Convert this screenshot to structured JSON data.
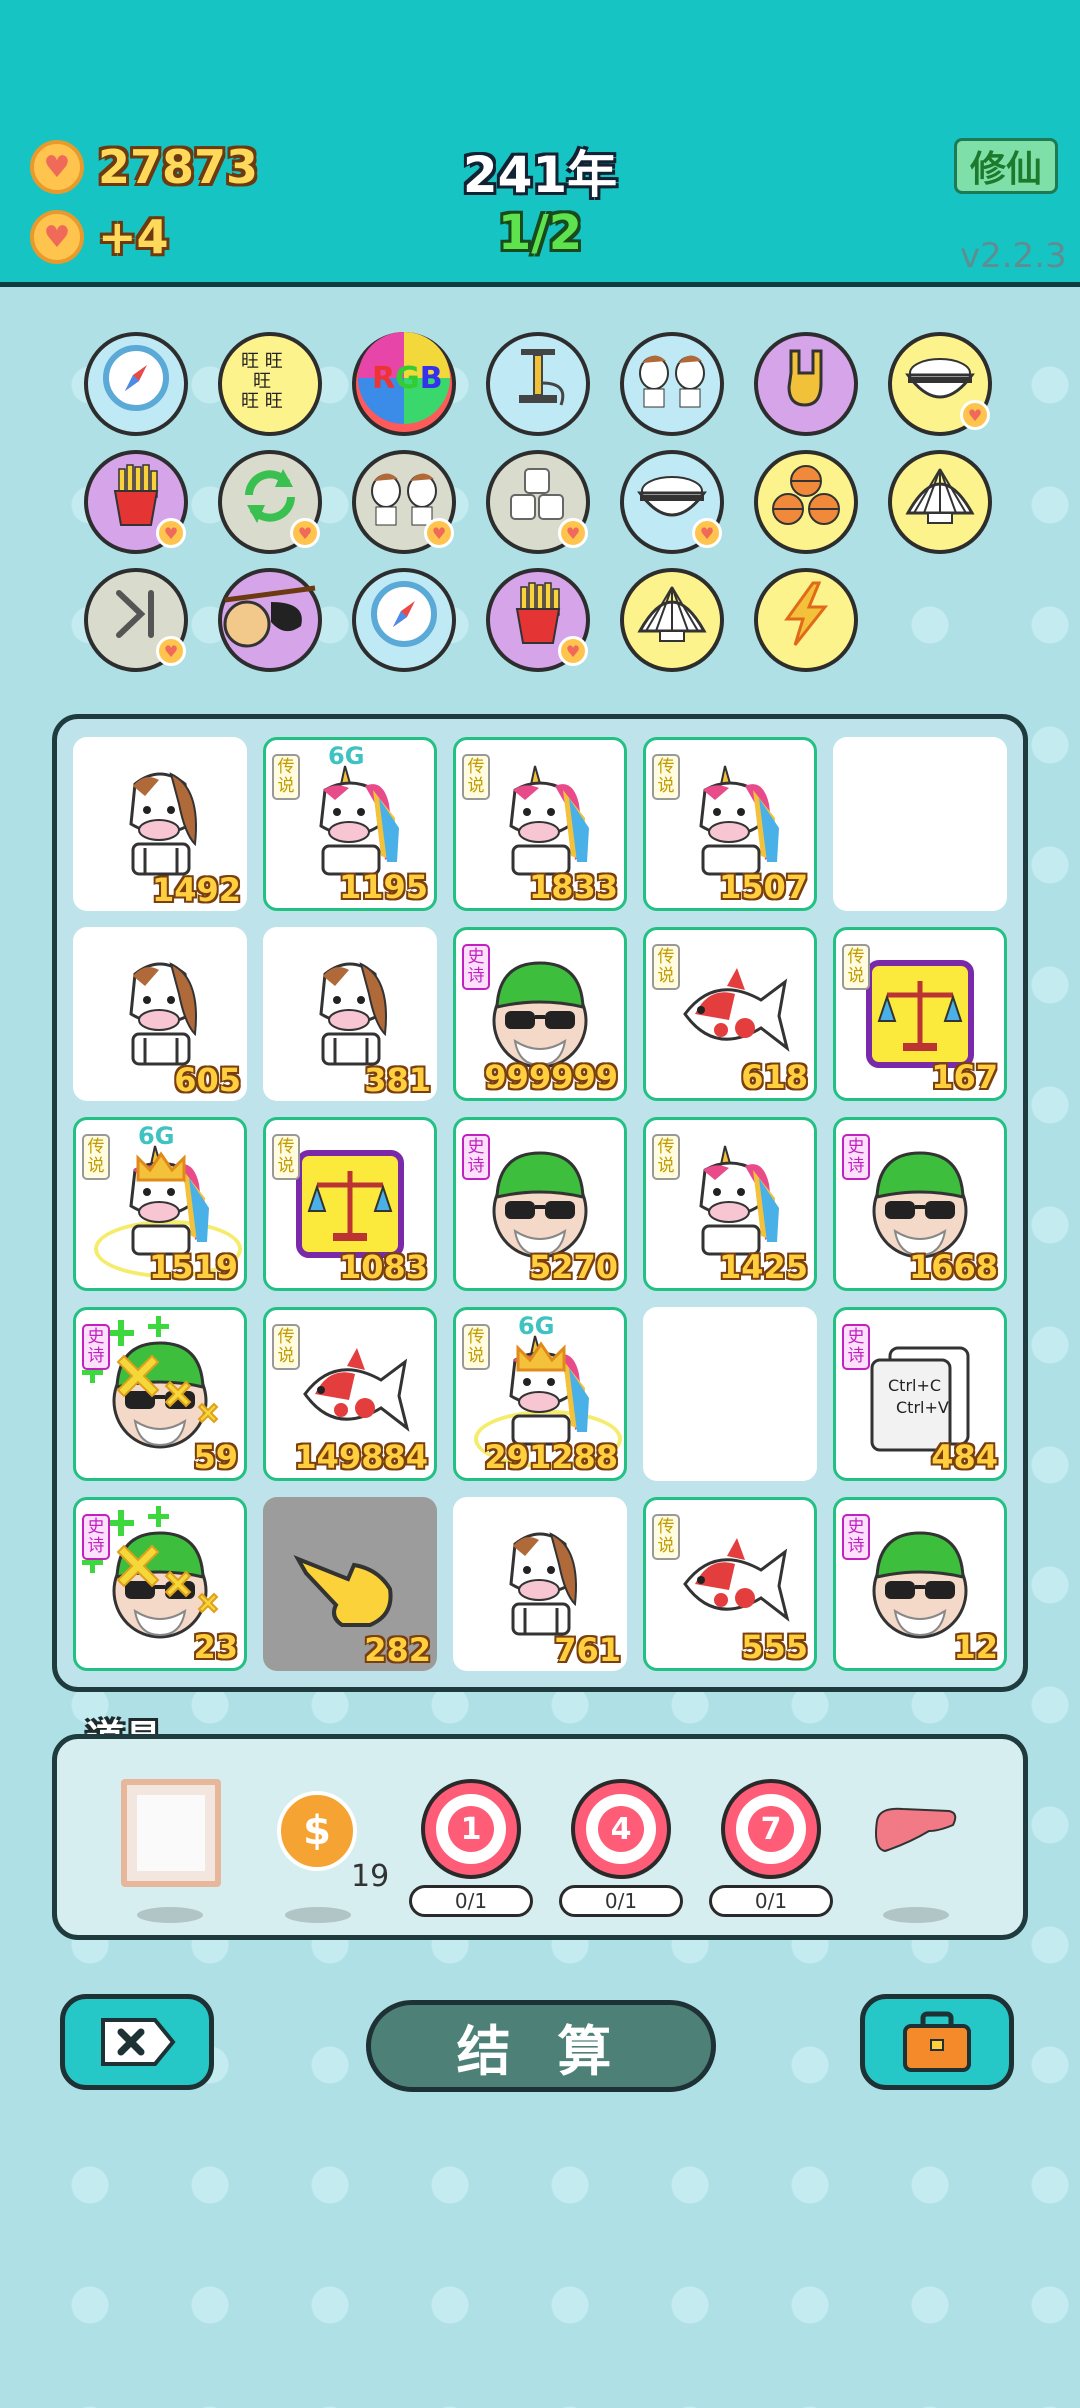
{
  "header": {
    "coins": "27873",
    "income": "+4",
    "year": "241年",
    "progress": "1/2",
    "mode_button": "修仙",
    "version": "v2.2.3"
  },
  "relics": [
    {
      "icon": "compass-icon",
      "color": "#bfe9f4"
    },
    {
      "icon": "wang-tiles-icon",
      "color": "#fdf38c"
    },
    {
      "icon": "rgb-icon",
      "color": "#ff5a5a"
    },
    {
      "icon": "pump-icon",
      "color": "#bfe9f4"
    },
    {
      "icon": "twin-horse-icon",
      "color": "#bfe9f4"
    },
    {
      "icon": "rock-hand-icon",
      "color": "#d6a4e8"
    },
    {
      "icon": "rice-bowl-icon",
      "color": "#fdf38c"
    },
    {
      "icon": "fries-icon",
      "color": "#d6a4e8"
    },
    {
      "icon": "refresh-icon",
      "color": "#d9dccc"
    },
    {
      "icon": "twin-horse-icon",
      "color": "#d9dccc"
    },
    {
      "icon": "sugar-cubes-icon",
      "color": "#d9dccc"
    },
    {
      "icon": "rice-bowl-icon",
      "color": "#bfe9f4"
    },
    {
      "icon": "basketballs-icon",
      "color": "#fdf38c"
    },
    {
      "icon": "shell-icon",
      "color": "#fdf38c"
    },
    {
      "icon": "skip-icon",
      "color": "#d9dccc"
    },
    {
      "icon": "eyepatch-icon",
      "color": "#d6a4e8"
    },
    {
      "icon": "compass-icon",
      "color": "#bfe9f4"
    },
    {
      "icon": "fries-icon",
      "color": "#d6a4e8"
    },
    {
      "icon": "shell-icon",
      "color": "#fdf38c"
    },
    {
      "icon": "lightning-icon",
      "color": "#fdf38c"
    }
  ],
  "tags": {
    "legend": "传说",
    "epic": "史诗"
  },
  "board": [
    {
      "kind": "horse",
      "value": "1492"
    },
    {
      "kind": "unicorn",
      "value": "1195",
      "tag": "legend",
      "g6": "6G"
    },
    {
      "kind": "unicorn",
      "value": "1833",
      "tag": "legend"
    },
    {
      "kind": "unicorn",
      "value": "1507",
      "tag": "legend"
    },
    {
      "kind": "empty",
      "value": ""
    },
    {
      "kind": "horse",
      "value": "605"
    },
    {
      "kind": "horse",
      "value": "381"
    },
    {
      "kind": "boss",
      "value": "999999",
      "tag": "epic"
    },
    {
      "kind": "fish",
      "value": "618",
      "tag": "legend"
    },
    {
      "kind": "scale",
      "value": "167",
      "tag": "legend"
    },
    {
      "kind": "unicorn",
      "value": "1519",
      "tag": "legend",
      "g6": "6G",
      "crown": true
    },
    {
      "kind": "scale",
      "value": "1083",
      "tag": "legend"
    },
    {
      "kind": "boss",
      "value": "5270",
      "tag": "epic"
    },
    {
      "kind": "unicorn",
      "value": "1425",
      "tag": "legend"
    },
    {
      "kind": "boss",
      "value": "1668",
      "tag": "epic"
    },
    {
      "kind": "boss",
      "value": "59",
      "tag": "epic",
      "hit": true
    },
    {
      "kind": "fish",
      "value": "149884",
      "tag": "legend"
    },
    {
      "kind": "unicorn",
      "value": "291288",
      "tag": "legend",
      "g6": "6G",
      "crown": true
    },
    {
      "kind": "empty",
      "value": ""
    },
    {
      "kind": "copypaste",
      "value": "484",
      "tag": "epic",
      "ctrlc": "Ctrl+C",
      "ctrlv": "Ctrl+V"
    },
    {
      "kind": "boss",
      "value": "23",
      "tag": "epic",
      "hit": true
    },
    {
      "kind": "hand",
      "value": "282",
      "dim": true
    },
    {
      "kind": "horse",
      "value": "761"
    },
    {
      "kind": "fish",
      "value": "555",
      "tag": "legend"
    },
    {
      "kind": "boss",
      "value": "12",
      "tag": "epic"
    }
  ],
  "props": {
    "label": "道具",
    "coin_count": "19",
    "targets": [
      {
        "number": "1",
        "uses": "0/1"
      },
      {
        "number": "4",
        "uses": "0/1"
      },
      {
        "number": "7",
        "uses": "0/1"
      }
    ]
  },
  "footer": {
    "settle_label": "结 算"
  }
}
